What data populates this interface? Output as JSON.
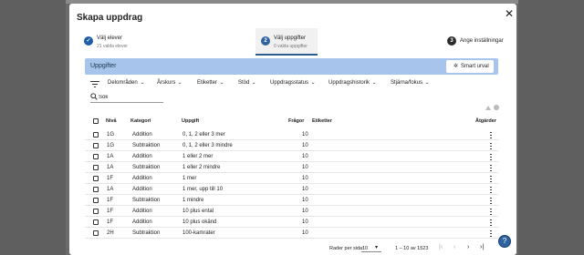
{
  "dialog": {
    "title": "Skapa uppdrag",
    "close_icon": "close-icon"
  },
  "stepper": [
    {
      "number": "✓",
      "label": "Välj elever",
      "sub": "21 valda elever",
      "state": "done"
    },
    {
      "number": "2",
      "label": "Välj uppgifter",
      "sub": "0 valda uppgifter",
      "state": "active"
    },
    {
      "number": "3",
      "label": "Ange inställningar",
      "sub": "",
      "state": "todo"
    }
  ],
  "banner": {
    "title": "Uppgifter",
    "smart_button": "Smart urval",
    "color": "#a7c5ec"
  },
  "filters": [
    {
      "label": "Delområden"
    },
    {
      "label": "Årskurs"
    },
    {
      "label": "Etiketter"
    },
    {
      "label": "Stöd"
    },
    {
      "label": "Uppdragsstatus"
    },
    {
      "label": "Uppdragshistorik"
    },
    {
      "label": "Stjärna/fokus"
    }
  ],
  "search": {
    "placeholder": "Sök",
    "value": ""
  },
  "table": {
    "columns": {
      "niva": "Nivå",
      "kategori": "Kategori",
      "uppgift": "Uppgift",
      "fragor": "Frågor",
      "etiketter": "Etiketter",
      "atgarder": "Åtgärder"
    },
    "rows": [
      {
        "niva": "1G",
        "kategori": "Addition",
        "uppgift": "0, 1, 2 eller 3 mer",
        "fragor": "10"
      },
      {
        "niva": "1G",
        "kategori": "Subtraktion",
        "uppgift": "0, 1, 2 eller 3 mindre",
        "fragor": "10"
      },
      {
        "niva": "1A",
        "kategori": "Addition",
        "uppgift": "1 eller 2 mer",
        "fragor": "10"
      },
      {
        "niva": "1A",
        "kategori": "Subtraktion",
        "uppgift": "1 eller 2 mindre",
        "fragor": "10"
      },
      {
        "niva": "1F",
        "kategori": "Addition",
        "uppgift": "1 mer",
        "fragor": "10"
      },
      {
        "niva": "1A",
        "kategori": "Addition",
        "uppgift": "1 mer, upp till 10",
        "fragor": "10"
      },
      {
        "niva": "1F",
        "kategori": "Subtraktion",
        "uppgift": "1 mindre",
        "fragor": "10"
      },
      {
        "niva": "1F",
        "kategori": "Addition",
        "uppgift": "10 plus ental",
        "fragor": "10"
      },
      {
        "niva": "1F",
        "kategori": "Addition",
        "uppgift": "10 plus okänd",
        "fragor": "10"
      },
      {
        "niva": "2H",
        "kategori": "Subtraktion",
        "uppgift": "100-kamrater",
        "fragor": "10"
      }
    ]
  },
  "pagination": {
    "rows_label": "Rader per sida:",
    "rows_value": "10",
    "range": "1 – 10 av 1523"
  }
}
